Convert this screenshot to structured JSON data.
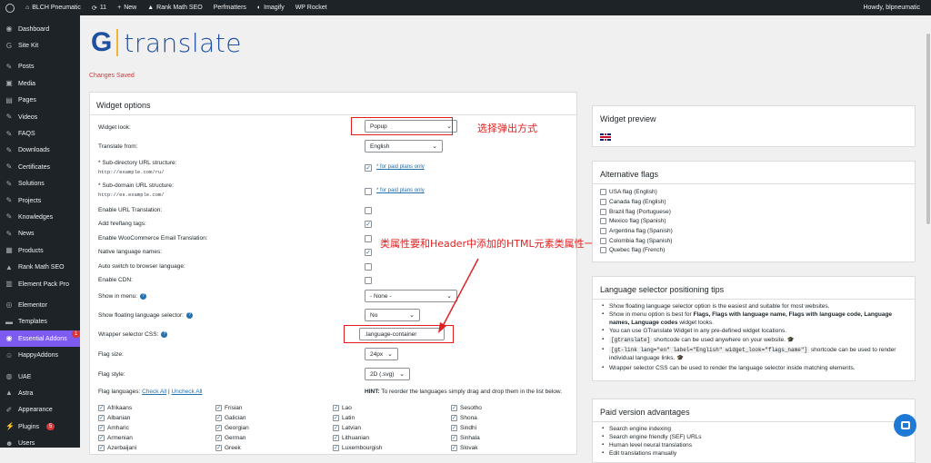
{
  "adminbar": {
    "site_name": "BLCH Pneumatic",
    "updates": "11",
    "new_label": "New",
    "items": [
      "Rank Math SEO",
      "Perfmatters",
      "Imagify",
      "WP Rocket"
    ],
    "howdy": "Howdy, blpneumatic"
  },
  "sidebar": {
    "items": [
      {
        "label": "Dashboard",
        "icon": "dashboard-icon"
      },
      {
        "label": "Site Kit",
        "icon": "g-icon"
      },
      {
        "label": "Posts",
        "icon": "pin-icon"
      },
      {
        "label": "Media",
        "icon": "media-icon"
      },
      {
        "label": "Pages",
        "icon": "page-icon"
      },
      {
        "label": "Videos",
        "icon": "pin-icon"
      },
      {
        "label": "FAQS",
        "icon": "pin-icon"
      },
      {
        "label": "Downloads",
        "icon": "pin-icon"
      },
      {
        "label": "Certificates",
        "icon": "pin-icon"
      },
      {
        "label": "Solutions",
        "icon": "pin-icon"
      },
      {
        "label": "Projects",
        "icon": "pin-icon"
      },
      {
        "label": "Knowledges",
        "icon": "pin-icon"
      },
      {
        "label": "News",
        "icon": "pin-icon"
      },
      {
        "label": "Products",
        "icon": "box-icon"
      },
      {
        "label": "Rank Math SEO",
        "icon": "chart-icon"
      },
      {
        "label": "Element Pack Pro",
        "icon": "grid-icon"
      },
      {
        "label": "Elementor",
        "icon": "elementor-icon"
      },
      {
        "label": "Templates",
        "icon": "folder-icon"
      },
      {
        "label": "Essential Addons",
        "icon": "ea-icon",
        "badge": "1"
      },
      {
        "label": "HappyAddons",
        "icon": "smile-icon"
      },
      {
        "label": "UAE",
        "icon": "uae-icon"
      },
      {
        "label": "Astra",
        "icon": "astra-icon"
      },
      {
        "label": "Appearance",
        "icon": "brush-icon"
      },
      {
        "label": "Plugins",
        "icon": "plug-icon",
        "badge": "5"
      },
      {
        "label": "Users",
        "icon": "user-icon"
      }
    ]
  },
  "logo": {
    "g": "G",
    "text": "translate"
  },
  "notice": "Changes Saved",
  "options": {
    "title": "Widget options",
    "widget_look_label": "Widget look:",
    "widget_look_value": "Popup",
    "translate_from_label": "Translate from:",
    "translate_from_value": "English",
    "subdir_label": "* Sub-directory URL structure:",
    "subdir_example": "http://example.com/ru/",
    "subdomain_label": "* Sub-domain URL structure:",
    "subdomain_example": "http://es.example.com/",
    "paid_link": "* for paid plans only",
    "enable_url_label": "Enable URL Translation:",
    "hreflang_label": "Add hreflang tags:",
    "woo_label": "Enable WooCommerce Email Translation:",
    "native_label": "Native language names:",
    "auto_switch_label": "Auto switch to browser language:",
    "cdn_label": "Enable CDN:",
    "show_menu_label": "Show in menu:",
    "show_menu_value": "- None -",
    "floating_label": "Show floating language selector:",
    "floating_value": "No",
    "wrapper_label": "Wrapper selector CSS:",
    "wrapper_value": ".language-container",
    "flag_size_label": "Flag size:",
    "flag_size_value": "24px",
    "flag_style_label": "Flag style:",
    "flag_style_value": "2D (.svg)",
    "flag_langs_label": "Flag languages:",
    "check_all": "Check All",
    "sep": "|",
    "uncheck_all": "Uncheck All",
    "hint_label": "HINT:",
    "hint_text": "To reorder the languages simply drag and drop them in the list below.",
    "languages": [
      [
        "Afrikaans",
        "Albanian",
        "Amharic",
        "Armenian",
        "Azerbaijani"
      ],
      [
        "Frisian",
        "Galician",
        "Georgian",
        "German",
        "Greek"
      ],
      [
        "Lao",
        "Latin",
        "Latvian",
        "Lithuanian",
        "Luxembourgish"
      ],
      [
        "Sesotho",
        "Shona",
        "Sindhi",
        "Sinhala",
        "Slovak"
      ]
    ]
  },
  "annotations": {
    "popup": "选择弹出方式",
    "class": "类属性要和Header中添加的HTML元素类属性一致"
  },
  "preview": {
    "title": "Widget preview"
  },
  "alt_flags": {
    "title": "Alternative flags",
    "items": [
      "USA flag (English)",
      "Canada flag (English)",
      "Brazil flag (Portuguese)",
      "Mexico flag (Spanish)",
      "Argentina flag (Spanish)",
      "Colombia flag (Spanish)",
      "Quebec flag (French)"
    ]
  },
  "tips": {
    "title": "Language selector positioning tips",
    "t1": "Show floating language selector option is the easiest and suitable for most websites.",
    "t2a": "Show in menu option is best for",
    "t2b": "Flags, Flags with language name, Flags with language code, Language names, Language codes",
    "t2c": "widget looks.",
    "t3": "You can use GTranslate Widget in any pre-defined widget locations.",
    "t4_code": "[gtranslate]",
    "t4": "shortcode can be used anywhere on your website.",
    "t5_code": "[gt-link lang=\"en\" label=\"English\" widget_look=\"flags_name\"]",
    "t5": "shortcode can be used to render individual language links.",
    "t6": "Wrapper selector CSS can be used to render the language selector inside matching elements."
  },
  "paid": {
    "title": "Paid version advantages",
    "items": [
      "Search engine indexing",
      "Search engine friendly (SEF) URLs",
      "Human level neural translations",
      "Edit translations manually"
    ]
  },
  "colors": {
    "accent": "#2271b1",
    "annotation": "#e02020",
    "active_menu": "#7d5bf1"
  }
}
